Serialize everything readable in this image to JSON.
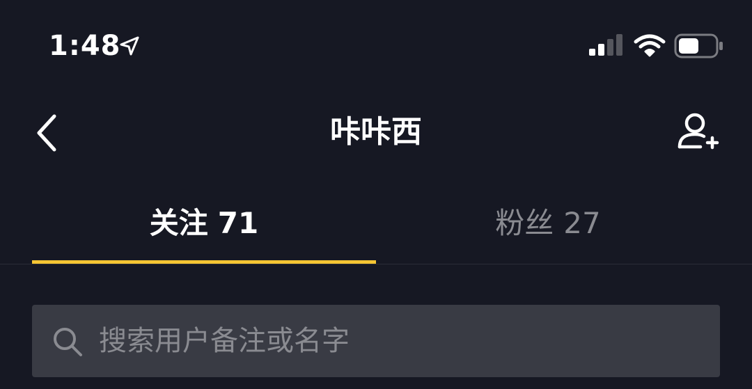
{
  "status_bar": {
    "time": "1:48",
    "icons": [
      "location-arrow-icon",
      "cellular-signal-icon",
      "wifi-icon",
      "battery-icon"
    ]
  },
  "header": {
    "title": "咔咔西",
    "back_icon": "chevron-left-icon",
    "add_friend_icon": "add-person-icon"
  },
  "tabs": [
    {
      "label": "关注",
      "count": "71",
      "active": true
    },
    {
      "label": "粉丝",
      "count": "27",
      "active": false
    }
  ],
  "search": {
    "placeholder": "搜索用户备注或名字",
    "value": ""
  },
  "colors": {
    "background": "#161823",
    "accent_indicator": "#f5c533",
    "search_bg": "#393b44",
    "inactive_text": "#8a8b91"
  }
}
